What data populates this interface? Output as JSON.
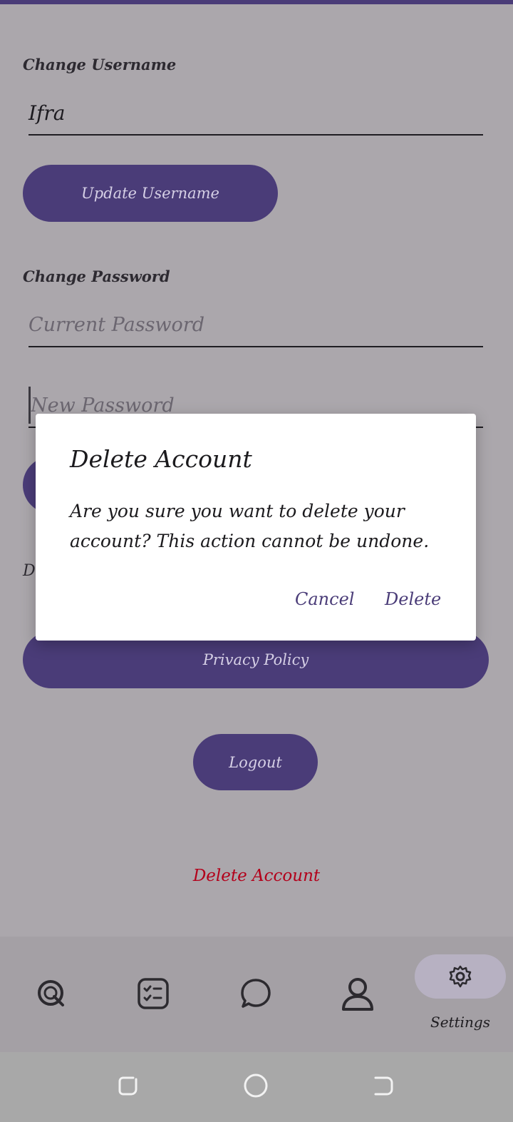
{
  "username_section": {
    "label": "Change Username",
    "value": "Ifra",
    "button_label": "Update Username"
  },
  "password_section": {
    "label": "Change Password",
    "current_placeholder": "Current Password",
    "new_placeholder": "New Password"
  },
  "partial_text": "D",
  "privacy_button": "Privacy Policy",
  "logout_button": "Logout",
  "delete_account_link": "Delete Account",
  "bottom_nav": {
    "items": [
      {
        "icon": "quiz-icon"
      },
      {
        "icon": "checklist-icon"
      },
      {
        "icon": "chat-icon"
      },
      {
        "icon": "profile-icon"
      },
      {
        "icon": "gear-icon",
        "label": "Settings",
        "active": true
      }
    ]
  },
  "dialog": {
    "title": "Delete Account",
    "message": "Are you sure you want to delete your account? This action cannot be undone.",
    "cancel_label": "Cancel",
    "confirm_label": "Delete"
  },
  "colors": {
    "accent": "#4a3c78",
    "danger": "#b3001a",
    "scrim_background": "#aba7ac"
  }
}
